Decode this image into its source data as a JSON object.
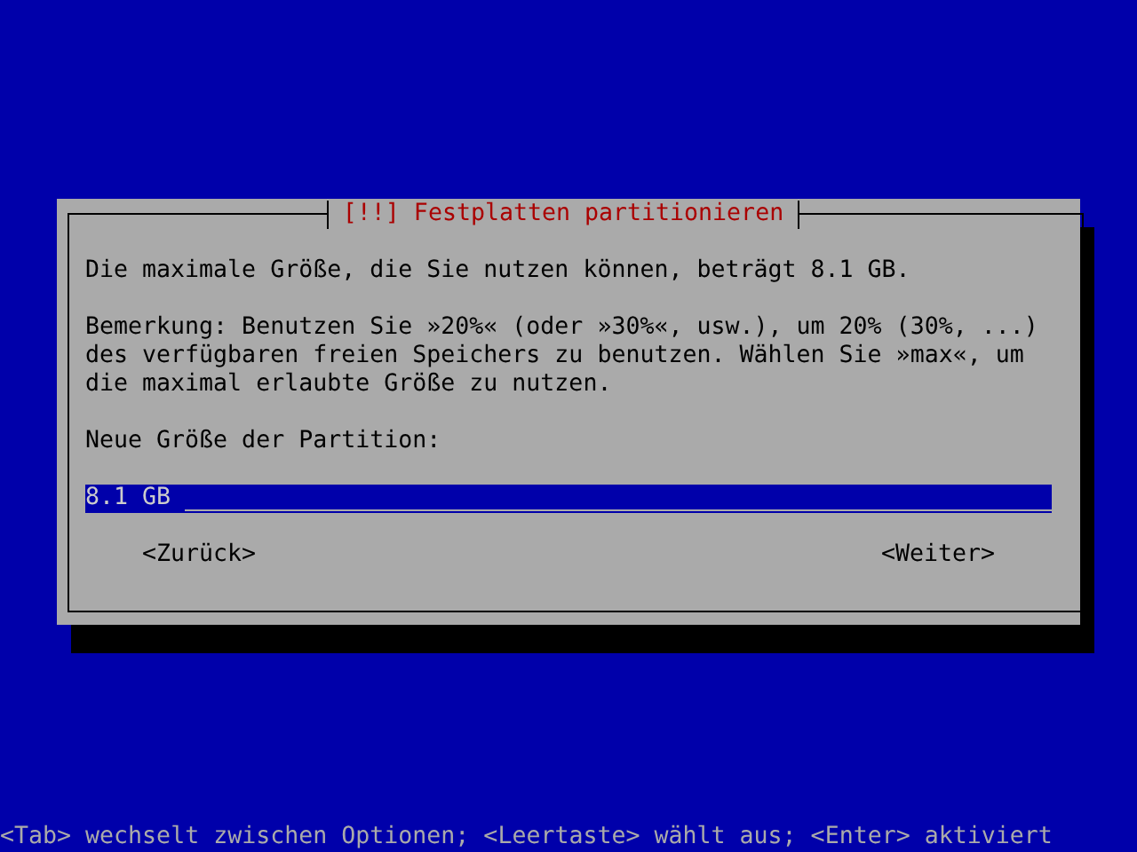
{
  "dialog": {
    "title": "[!!] Festplatten partitionieren",
    "paragraphs": [
      "Die maximale Größe, die Sie nutzen können, beträgt 8.1 GB.",
      "Bemerkung: Benutzen Sie »20%« (oder »30%«, usw.), um 20% (30%, ...) des verfügbaren freien Speichers zu benutzen. Wählen Sie »max«, um die maximal erlaubte Größe zu nutzen."
    ],
    "field": {
      "label": "Neue Größe der Partition:",
      "value": "8.1 GB"
    },
    "buttons": [
      {
        "label": "<Zurück>"
      },
      {
        "label": "<Weiter>"
      }
    ]
  },
  "status_bar": "<Tab> wechselt zwischen Optionen; <Leertaste> wählt aus; <Enter> aktiviert"
}
